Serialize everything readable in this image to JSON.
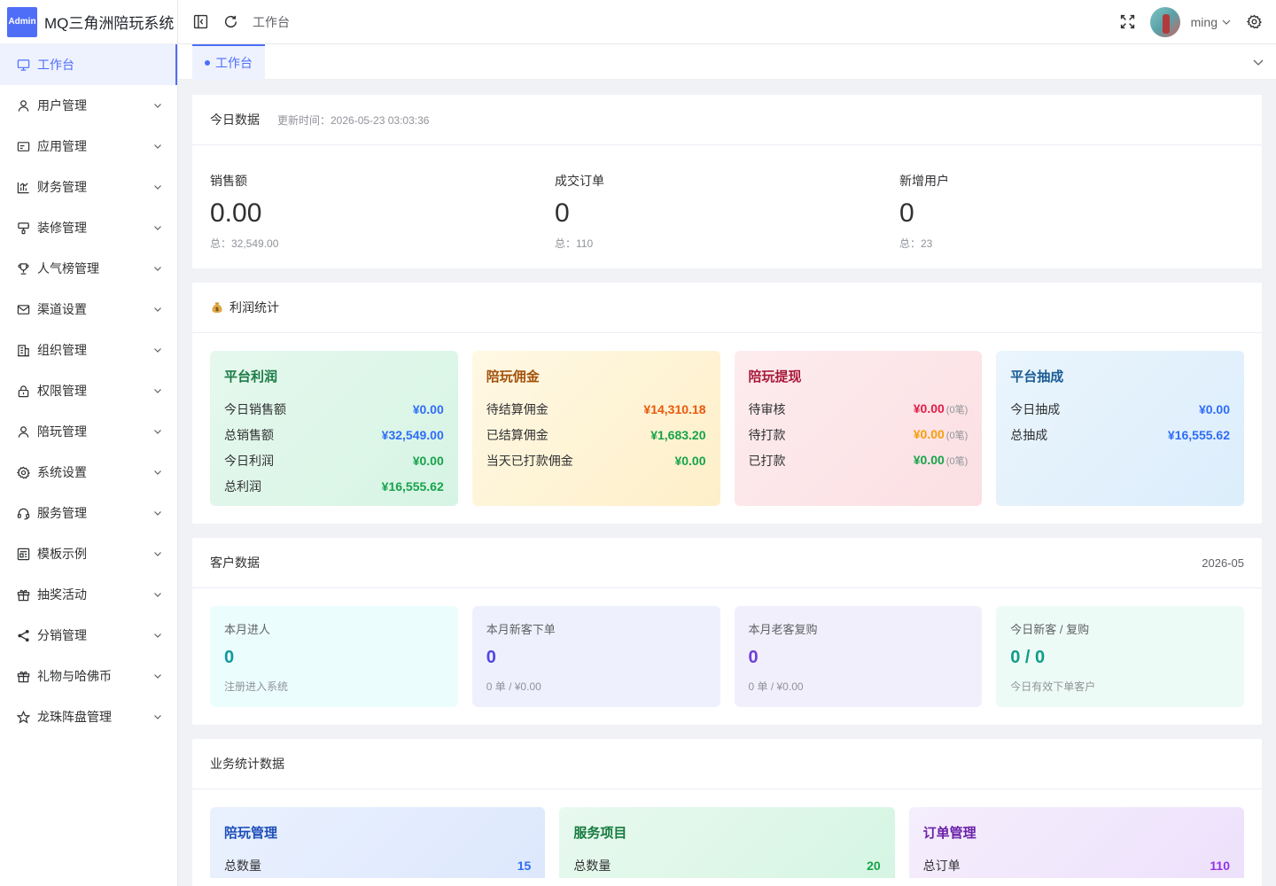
{
  "app": {
    "badge": "Admin",
    "title": "MQ三角洲陪玩系统"
  },
  "sidebar": {
    "items": [
      {
        "label": "工作台",
        "icon": "monitor-icon",
        "active": true,
        "expandable": false
      },
      {
        "label": "用户管理",
        "icon": "user-icon",
        "expandable": true
      },
      {
        "label": "应用管理",
        "icon": "app-icon",
        "expandable": true
      },
      {
        "label": "财务管理",
        "icon": "chart-icon",
        "expandable": true
      },
      {
        "label": "装修管理",
        "icon": "brush-icon",
        "expandable": true
      },
      {
        "label": "人气榜管理",
        "icon": "trophy-icon",
        "expandable": true
      },
      {
        "label": "渠道设置",
        "icon": "mail-icon",
        "expandable": true
      },
      {
        "label": "组织管理",
        "icon": "building-icon",
        "expandable": true
      },
      {
        "label": "权限管理",
        "icon": "lock-icon",
        "expandable": true
      },
      {
        "label": "陪玩管理",
        "icon": "user-icon",
        "expandable": true
      },
      {
        "label": "系统设置",
        "icon": "gear-icon",
        "expandable": true
      },
      {
        "label": "服务管理",
        "icon": "headset-icon",
        "expandable": true
      },
      {
        "label": "模板示例",
        "icon": "template-icon",
        "expandable": true
      },
      {
        "label": "抽奖活动",
        "icon": "gift-icon",
        "expandable": true
      },
      {
        "label": "分销管理",
        "icon": "share-icon",
        "expandable": true
      },
      {
        "label": "礼物与哈佛币",
        "icon": "gift-icon",
        "expandable": true
      },
      {
        "label": "龙珠阵盘管理",
        "icon": "star-icon",
        "expandable": true
      }
    ]
  },
  "header": {
    "breadcrumb": "工作台",
    "username": "ming"
  },
  "tabs": [
    {
      "label": "工作台"
    }
  ],
  "today": {
    "title": "今日数据",
    "updated": "更新时间：2026-05-23 03:03:36",
    "stats": [
      {
        "label": "销售额",
        "value": "0.00",
        "total": "总：32,549.00"
      },
      {
        "label": "成交订单",
        "value": "0",
        "total": "总：110"
      },
      {
        "label": "新增用户",
        "value": "0",
        "total": "总：23"
      }
    ]
  },
  "profit": {
    "title": "利润统计",
    "icon": "money-bag-icon",
    "cards": [
      {
        "title": "平台利润",
        "theme": "green",
        "rows": [
          {
            "label": "今日销售额",
            "value": "¥0.00",
            "color": "blue"
          },
          {
            "label": "总销售额",
            "value": "¥32,549.00",
            "color": "blue"
          },
          {
            "label": "今日利润",
            "value": "¥0.00",
            "color": "green"
          },
          {
            "label": "总利润",
            "value": "¥16,555.62",
            "color": "green"
          }
        ]
      },
      {
        "title": "陪玩佣金",
        "theme": "yellow",
        "rows": [
          {
            "label": "待结算佣金",
            "value": "¥14,310.18",
            "color": "orange"
          },
          {
            "label": "已结算佣金",
            "value": "¥1,683.20",
            "color": "green"
          },
          {
            "label": "当天已打款佣金",
            "value": "¥0.00",
            "color": "green"
          }
        ]
      },
      {
        "title": "陪玩提现",
        "theme": "pink",
        "rows": [
          {
            "label": "待审核",
            "value": "¥0.00",
            "count": "(0笔)",
            "color": "red"
          },
          {
            "label": "待打款",
            "value": "¥0.00",
            "count": "(0笔)",
            "color": "amber"
          },
          {
            "label": "已打款",
            "value": "¥0.00",
            "count": "(0笔)",
            "color": "green"
          }
        ]
      },
      {
        "title": "平台抽成",
        "theme": "blue",
        "rows": [
          {
            "label": "今日抽成",
            "value": "¥0.00",
            "color": "blue"
          },
          {
            "label": "总抽成",
            "value": "¥16,555.62",
            "color": "blue"
          }
        ]
      }
    ]
  },
  "customer": {
    "title": "客户数据",
    "period": "2026-05",
    "cards": [
      {
        "label": "本月进人",
        "value": "0",
        "sub": "注册进入系统"
      },
      {
        "label": "本月新客下单",
        "value": "0",
        "sub": "0 单 / ¥0.00"
      },
      {
        "label": "本月老客复购",
        "value": "0",
        "sub": "0 单 / ¥0.00"
      },
      {
        "label": "今日新客 / 复购",
        "value": "0 / 0",
        "sub": "今日有效下单客户"
      }
    ]
  },
  "business": {
    "title": "业务统计数据",
    "cards": [
      {
        "title": "陪玩管理",
        "label": "总数量",
        "value": "15"
      },
      {
        "title": "服务项目",
        "label": "总数量",
        "value": "20"
      },
      {
        "title": "订单管理",
        "label": "总订单",
        "value": "110"
      }
    ]
  },
  "colors": {
    "accent": "#4f6ef7"
  }
}
